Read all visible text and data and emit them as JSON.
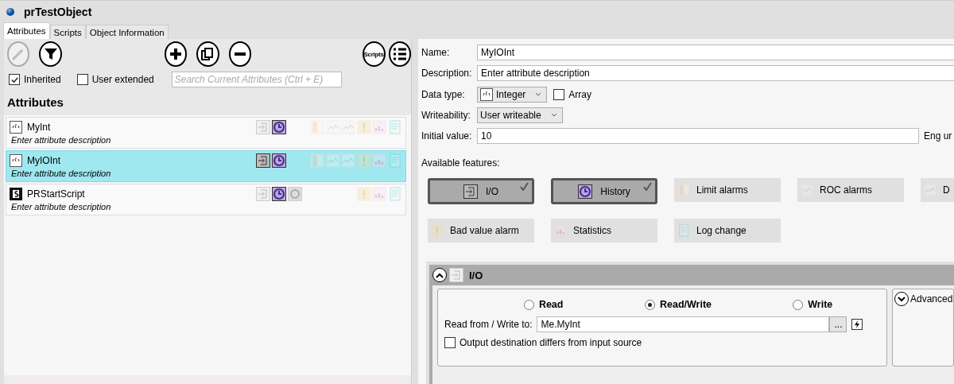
{
  "window": {
    "title": "prTestObject"
  },
  "tabs": [
    {
      "label": "Attributes",
      "selected": true
    },
    {
      "label": "Scripts",
      "selected": false
    },
    {
      "label": "Object Information",
      "selected": false
    }
  ],
  "toolbar": {
    "scripts_button": "Scripts"
  },
  "filters": [
    {
      "label": "Inherited",
      "checked": true
    },
    {
      "label": "User extended",
      "checked": false
    }
  ],
  "search": {
    "placeholder": "Search Current Attributes (Ctrl + E)"
  },
  "attributes": {
    "heading": "Attributes",
    "rows": [
      {
        "kind": "integer",
        "name": "MyInt",
        "description": "Enter attribute description",
        "selected": false,
        "icons": [
          {
            "kind": "io",
            "on": false
          },
          {
            "kind": "history",
            "on": true
          }
        ],
        "features": [
          {
            "kind": "limit"
          },
          {
            "kind": "roc"
          },
          {
            "kind": "deviation"
          },
          {
            "kind": "bad"
          },
          {
            "kind": "stats"
          },
          {
            "kind": "log"
          }
        ]
      },
      {
        "kind": "integer",
        "name": "MyIOInt",
        "description": "Enter attribute description",
        "selected": true,
        "icons": [
          {
            "kind": "io",
            "on": true
          },
          {
            "kind": "history",
            "on": true
          }
        ],
        "features": [
          {
            "kind": "limit"
          },
          {
            "kind": "roc"
          },
          {
            "kind": "deviation"
          },
          {
            "kind": "bad"
          },
          {
            "kind": "stats"
          },
          {
            "kind": "log"
          }
        ]
      },
      {
        "kind": "script",
        "name": "PRStartScript",
        "description": "Enter attribute description",
        "selected": false,
        "icons": [
          {
            "kind": "io",
            "on": false
          },
          {
            "kind": "history",
            "on": true
          },
          {
            "kind": "script",
            "on": false
          }
        ],
        "features": [
          {
            "kind": "bad"
          },
          {
            "kind": "stats"
          },
          {
            "kind": "log"
          }
        ]
      }
    ]
  },
  "form": {
    "name_label": "Name:",
    "name": "MyIOInt",
    "description_label": "Description:",
    "description": "Enter attribute description",
    "data_type_label": "Data type:",
    "data_type": "Integer",
    "array": {
      "label": "Array",
      "checked": false
    },
    "writeability_label": "Writeability:",
    "writeability": "User writeable",
    "initial_value_label": "Initial value:",
    "initial_value": "10",
    "eng_units_label": "Eng ur"
  },
  "features_label": "Available features:",
  "features": [
    {
      "kind": "io",
      "label": "I/O",
      "selected": true
    },
    {
      "kind": "history",
      "label": "History",
      "selected": true
    },
    {
      "kind": "limit",
      "label": "Limit alarms",
      "selected": false
    },
    {
      "kind": "roc",
      "label": "ROC alarms",
      "selected": false
    },
    {
      "kind": "deviation",
      "label": "D",
      "selected": false
    },
    {
      "kind": "bad",
      "label": "Bad value alarm",
      "selected": false
    },
    {
      "kind": "stats",
      "label": "Statistics",
      "selected": false
    },
    {
      "kind": "log",
      "label": "Log change",
      "selected": false
    }
  ],
  "io_section": {
    "title": "I/O",
    "expanded": true,
    "modes": [
      {
        "label": "Read",
        "selected": false
      },
      {
        "label": "Read/Write",
        "selected": true
      },
      {
        "label": "Write",
        "selected": false
      }
    ],
    "source_label": "Read from / Write to:",
    "source": "Me.MyInt",
    "browse": "...",
    "differs": {
      "label": "Output destination differs from input source",
      "checked": false
    },
    "advanced": {
      "label": "Advanced",
      "expanded": false
    }
  }
}
